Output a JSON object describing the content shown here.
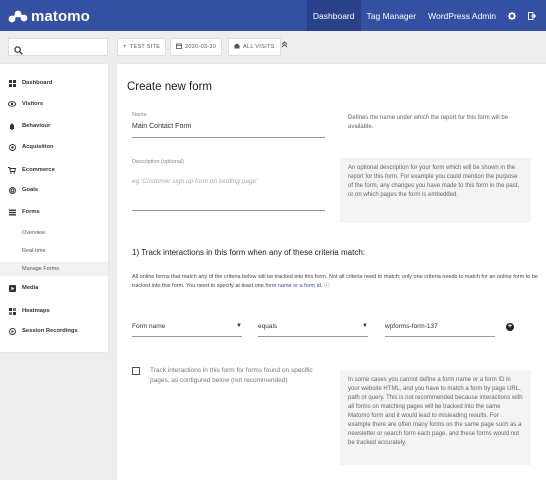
{
  "brand": {
    "name": "matomo"
  },
  "topnav": {
    "items": [
      "Dashboard",
      "Tag Manager",
      "WordPress Admin"
    ],
    "active": 0
  },
  "toolbar": {
    "site_label": "TEST SITE",
    "date_label": "2020-03-30",
    "segment_label": "ALL VISITS"
  },
  "sidebar": {
    "items": [
      {
        "label": "Dashboard",
        "icon": "dashboard-icon"
      },
      {
        "label": "Visitors",
        "icon": "visitors-icon"
      },
      {
        "label": "Behaviour",
        "icon": "behaviour-icon"
      },
      {
        "label": "Acquisition",
        "icon": "acquisition-icon"
      },
      {
        "label": "Ecommerce",
        "icon": "ecommerce-icon"
      },
      {
        "label": "Goals",
        "icon": "goals-icon"
      },
      {
        "label": "Forms",
        "icon": "forms-icon"
      },
      {
        "label": "Media",
        "icon": "media-icon"
      },
      {
        "label": "Heatmaps",
        "icon": "heatmaps-icon"
      },
      {
        "label": "Session Recordings",
        "icon": "session-recordings-icon"
      }
    ],
    "forms_subitems": [
      "Overview",
      "Real-time",
      "Manage Forms"
    ],
    "active_subitem": "Manage Forms"
  },
  "form": {
    "title": "Create new form",
    "name_label": "Name",
    "name_value": "Main Contact Form",
    "name_help": "Defines the name under which the report for this form will be available.",
    "description_label": "Description (optional)",
    "description_placeholder": "eg 'Customer sign up form on landing page'",
    "description_help": "An optional description for your form which will be shown in the report for this form. For example you could mention the purpose of the form, any changes you have made to this form in the past, or on which pages the form is embedded.",
    "section_heading": "1) Track interactions in this form when any of these criteria match:",
    "intro_text": "All online forms that match any of the criteria below will be tracked into this form. Not all criteria need to match; only one criteria needs to match for an online form to be tracked into this form. You need to specify at least one ",
    "intro_link": "form name or a form id",
    "intro_end": ". ⓘ",
    "rule_attribute": "Form name",
    "rule_operator": "equals",
    "rule_value": "wpforms-form-137",
    "checkbox_label": "Track interactions in this form for forms found on specific pages, as configured below (not recommended)",
    "checkbox_checked": false,
    "pages_help": "In some cases you cannot define a form name or a form ID in your website HTML, and you have to match a form by page URL, path or query. This is not recommended because interactions with all forms on matching pages will be tracked into the same Matomo form and it would lead to misleading results. For example there are often many forms on the same page such as a newsletter or search form each page, and these forms would not be tracked accurately."
  },
  "colors": {
    "topbar": "#3450a3",
    "topbar_active": "#2a428a",
    "link": "#3450a3"
  }
}
